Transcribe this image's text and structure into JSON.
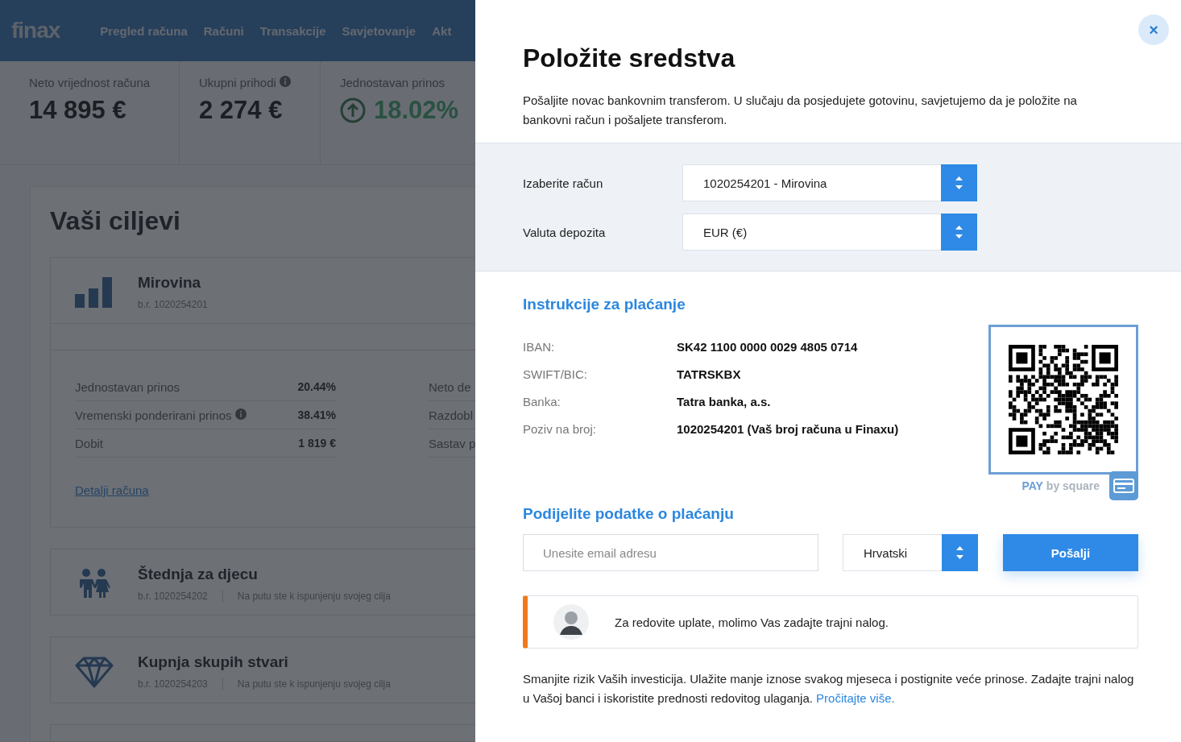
{
  "background": {
    "logo": "finax",
    "nav": [
      "Pregled računa",
      "Računi",
      "Transakcije",
      "Savjetovanje",
      "Akt"
    ],
    "stats": [
      {
        "label": "Neto vrijednost računa",
        "value": "14 895 €",
        "info": false,
        "kind": "plain"
      },
      {
        "label": "Ukupni prihodi",
        "value": "2 274 €",
        "info": true,
        "kind": "plain"
      },
      {
        "label": "Jednostavan prinos",
        "value": "18.02%",
        "info": false,
        "kind": "trend"
      }
    ],
    "goals_title": "Vaši ciljevi",
    "goals": [
      {
        "kind": "bars",
        "name": "Mirovina",
        "account": "b.r. 1020254201",
        "expanded": true,
        "metrics": [
          {
            "label": "Jednostavan prinos",
            "value": "20.44%",
            "info": false
          },
          {
            "label": "Vremenski ponderirani prinos",
            "value": "38.41%",
            "info": true
          },
          {
            "label": "Dobit",
            "value": "1 819 €",
            "info": false
          }
        ],
        "metrics_right": [
          "Neto de",
          "Razdobl",
          "Sastav p"
        ],
        "link": "Detalji računa"
      },
      {
        "kind": "children",
        "name": "Štednja za djecu",
        "account": "b.r. 1020254202",
        "status": "Na putu ste k ispunjenju svojeg cilja",
        "expanded": false
      },
      {
        "kind": "diamond",
        "name": "Kupnja skupih stvari",
        "account": "b.r. 1020254203",
        "status": "Na putu ste k ispunjenju svojeg cilja",
        "expanded": false
      }
    ]
  },
  "modal": {
    "close": "×",
    "title": "Položite sredstva",
    "intro": "Pošaljite novac bankovnim transferom. U slučaju da posjedujete gotovinu, savjetujemo da je položite na bankovni račun i pošaljete transferom.",
    "selects": [
      {
        "label": "Izaberite račun",
        "value": "1020254201 - Mirovina"
      },
      {
        "label": "Valuta depozita",
        "value": "EUR (€)"
      }
    ],
    "instructions_title": "Instrukcije za plaćanje",
    "payment_details": [
      {
        "label": "IBAN:",
        "value": "SK42 1100 0000 0029 4805 0714"
      },
      {
        "label": "SWIFT/BIC:",
        "value": "TATRSKBX"
      },
      {
        "label": "Banka:",
        "value": "Tatra banka, a.s."
      },
      {
        "label": "Poziv na broj:",
        "value": "1020254201 (Vaš broj računa u Finaxu)"
      }
    ],
    "qr_caption": "**PAY** by square",
    "share_title": "Podijelite podatke o plaćanju",
    "email_placeholder": "Unesite email adresu",
    "language": "Hrvatski",
    "send": "Pošalji",
    "notice": "Za redovite uplate, molimo Vas zadajte trajni nalog.",
    "footer": "Smanjite rizik Vaših investicija. Ulažite manje iznose svakog mjeseca i postignite veće prinose. Zadajte trajni nalog u Vašoj banci i iskoristite prednosti redovitog ulaganja.",
    "footer_link": "Pročitajte više."
  }
}
